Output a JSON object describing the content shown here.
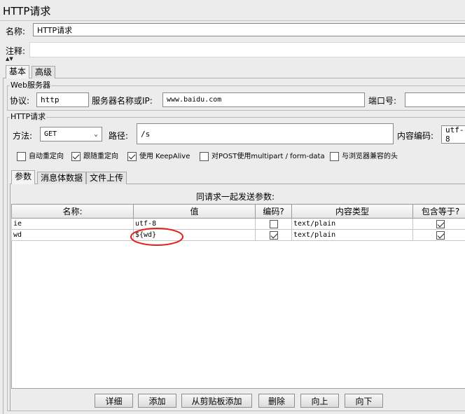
{
  "window": {
    "title": "HTTP请求"
  },
  "name_row": {
    "label": "名称:",
    "value": "HTTP请求"
  },
  "comment_row": {
    "label": "注释:",
    "value": ""
  },
  "top_tabs": [
    {
      "label": "基本",
      "active": true
    },
    {
      "label": "高级",
      "active": false
    }
  ],
  "web_server": {
    "legend": "Web服务器",
    "protocol_label": "协议:",
    "protocol_value": "http",
    "server_label": "服务器名称或IP:",
    "server_value": "www.baidu.com",
    "port_label": "端口号:",
    "port_value": ""
  },
  "http_request": {
    "legend": "HTTP请求",
    "method_label": "方法:",
    "method_value": "GET",
    "path_label": "路径:",
    "path_value": "/s",
    "encoding_label": "内容编码:",
    "encoding_value": "utf-8"
  },
  "options": [
    {
      "label": "自动重定向",
      "checked": false
    },
    {
      "label": "跟随重定向",
      "checked": true
    },
    {
      "label": "使用 KeepAlive",
      "checked": true
    },
    {
      "label": "对POST使用multipart / form-data",
      "checked": false
    },
    {
      "label": "与浏览器兼容的头",
      "checked": false
    }
  ],
  "param_tabs": [
    {
      "label": "参数",
      "active": true
    },
    {
      "label": "消息体数据",
      "active": false
    },
    {
      "label": "文件上传",
      "active": false
    }
  ],
  "params_table": {
    "caption": "同请求一起发送参数:",
    "columns": [
      "名称:",
      "值",
      "编码?",
      "内容类型",
      "包含等于?"
    ],
    "rows": [
      {
        "name": "ie",
        "value": "utf-8",
        "encode": false,
        "content_type": "text/plain",
        "include_equals": true
      },
      {
        "name": "wd",
        "value": "${wd}",
        "encode": true,
        "content_type": "text/plain",
        "include_equals": true
      }
    ]
  },
  "buttons": [
    "详细",
    "添加",
    "从剪贴板添加",
    "删除",
    "向上",
    "向下"
  ],
  "colors": {
    "annotation_circle": "#e02020",
    "background": "#ececec"
  },
  "icons": {
    "splitter": "collapse-arrows-icon",
    "dropdown": "chevron-down-icon"
  }
}
